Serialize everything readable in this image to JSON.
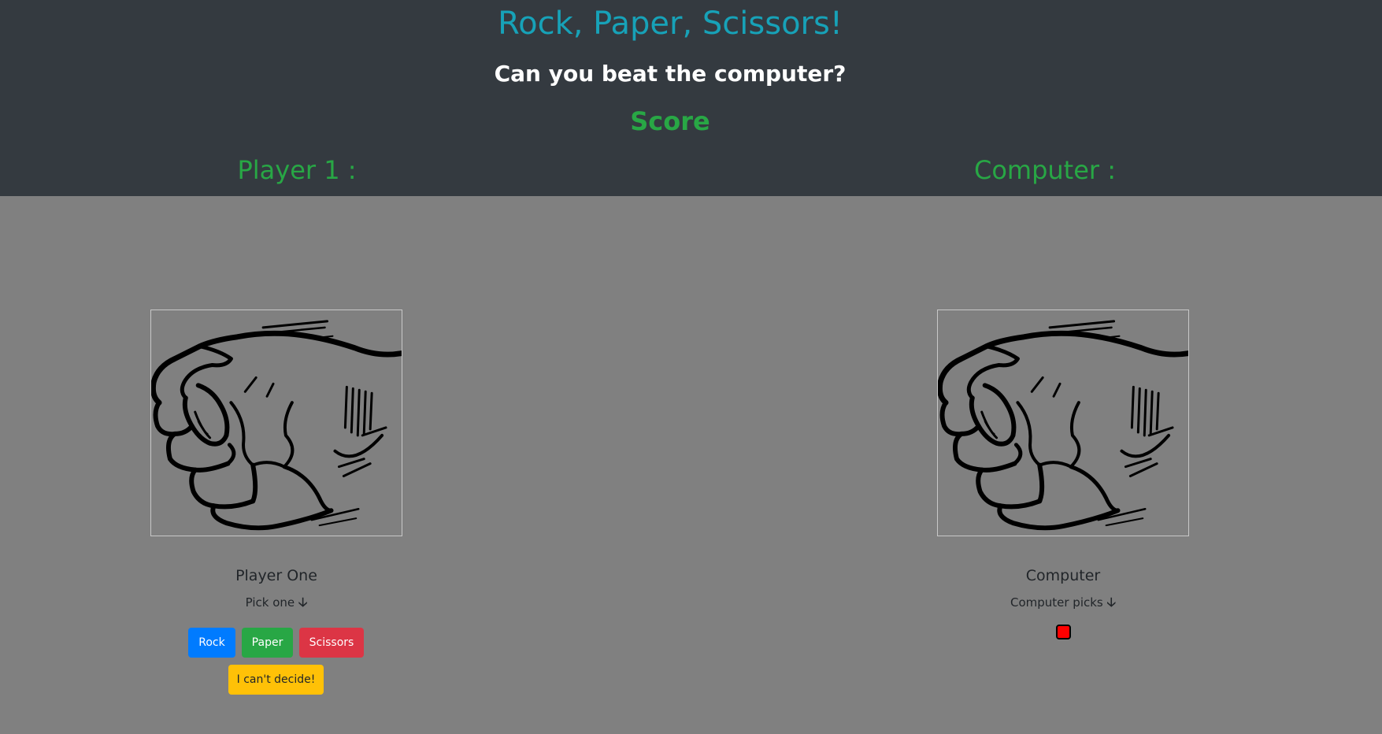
{
  "header": {
    "title": "Rock, Paper, Scissors!",
    "subtitle": "Can you beat the computer?",
    "score_heading": "Score",
    "player_score_label": "Player 1 :",
    "computer_score_label": "Computer :"
  },
  "player": {
    "image_icon": "rock-fist-icon",
    "name": "Player One",
    "hint": "Pick one",
    "arrow": "🡣",
    "buttons": {
      "rock": "Rock",
      "paper": "Paper",
      "scissors": "Scissors",
      "random": "I can't decide!"
    }
  },
  "computer": {
    "image_icon": "rock-fist-icon",
    "name": "Computer",
    "hint": "Computer picks",
    "arrow": "🡣",
    "indicator_color": "#ff0000"
  },
  "colors": {
    "header_bg": "#343a40",
    "page_bg": "#808080",
    "title": "#17a2b8",
    "score": "#28a745",
    "rock_button": "#007bff",
    "paper_button": "#28a745",
    "scissors_button": "#dc3545",
    "random_button": "#ffc107"
  }
}
